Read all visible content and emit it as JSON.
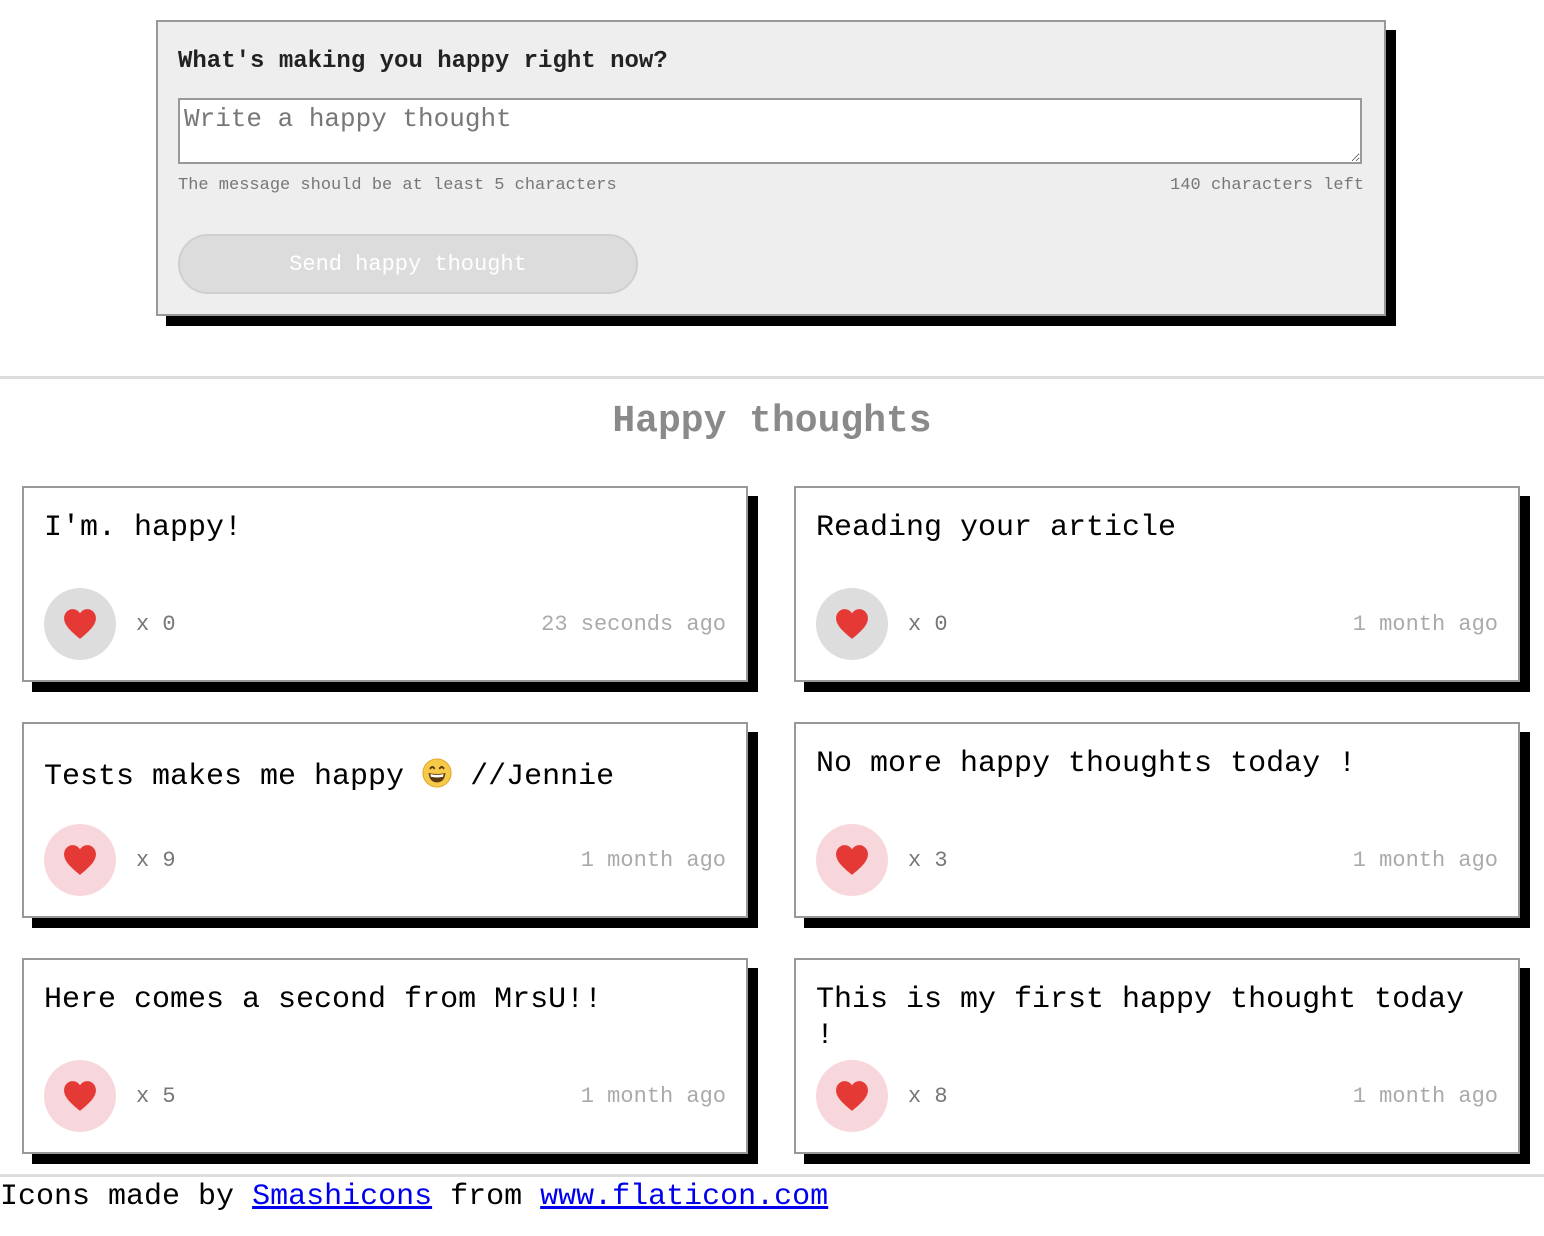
{
  "form": {
    "title": "What's making you happy right now?",
    "placeholder": "Write a happy thought",
    "value": "",
    "hint": "The message should be at least 5 characters",
    "counter": "140 characters left",
    "send_label": "Send happy thought"
  },
  "feed": {
    "title": "Happy thoughts",
    "thoughts": [
      {
        "message": "I'm. happy!",
        "likes": "x 0",
        "time": "23 seconds ago",
        "liked": false
      },
      {
        "message": "Reading your article",
        "likes": "x 0",
        "time": "1 month ago",
        "liked": false
      },
      {
        "message_before": "Tests makes me happy",
        "message_after": "//Jennie",
        "emoji": "grinning-face-icon",
        "likes": "x 9",
        "time": "1 month ago",
        "liked": true
      },
      {
        "message": "No more happy thoughts today !",
        "likes": "x 3",
        "time": "1 month ago",
        "liked": true
      },
      {
        "message": "Here comes a second from MrsU!!",
        "likes": "x 5",
        "time": "1 month ago",
        "liked": true
      },
      {
        "message": "This is my first happy thought today !",
        "likes": "x 8",
        "time": "1 month ago",
        "liked": true
      }
    ]
  },
  "footer": {
    "prefix": "Icons made by",
    "author_link": "Smashicons",
    "middle": "from",
    "site_link": "www.flaticon.com"
  },
  "icons": {
    "like": "heart-icon"
  },
  "colors": {
    "form_background": "#eeeeee",
    "heart": "#e53935",
    "liked_button": "#f8d7dc",
    "unliked_button": "#dddddd",
    "title_gray": "#8a8a8a"
  }
}
